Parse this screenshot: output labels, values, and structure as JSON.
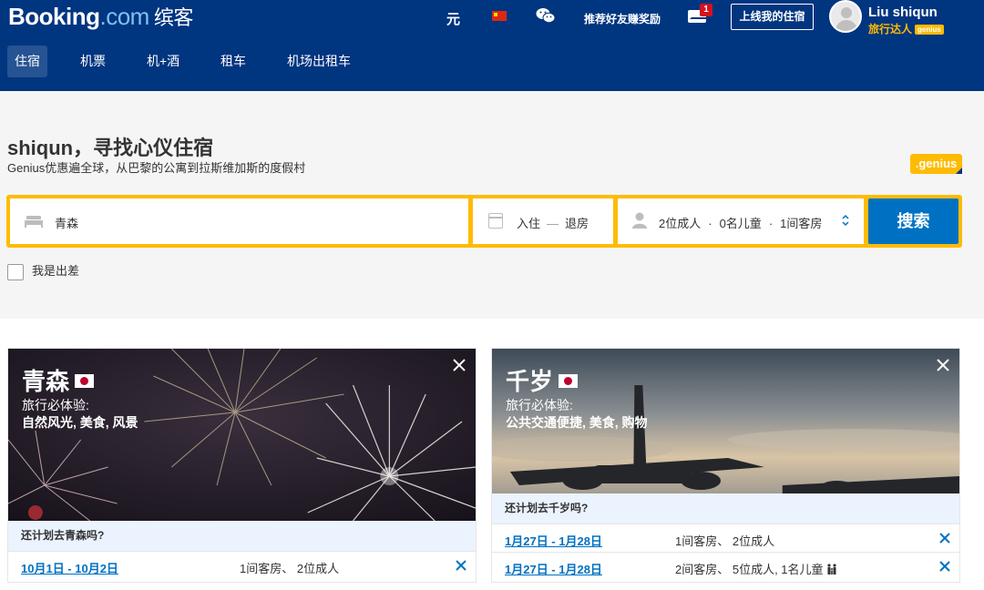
{
  "header": {
    "logo_main": "Booking",
    "logo_dotcom": ".com",
    "logo_cn": "缤客",
    "currency": "元",
    "language_icon": "china-flag-icon",
    "wechat_icon": "wechat-icon",
    "refer_label": "推荐好友赚奖励",
    "messages_icon": "mail-icon",
    "messages_count": "1",
    "list_property_label": "上线我的住宿",
    "user_name": "Liu shiqun",
    "user_level": "旅行达人",
    "user_badge": "genius"
  },
  "nav": {
    "tabs": [
      {
        "label": "住宿",
        "active": true
      },
      {
        "label": "机票",
        "active": false
      },
      {
        "label": "机+酒",
        "active": false
      },
      {
        "label": "租车",
        "active": false
      },
      {
        "label": "机场出租车",
        "active": false
      }
    ]
  },
  "hero": {
    "title": "shiqun，寻找心仪住宿",
    "subtitle": "Genius优惠遍全球，从巴黎的公寓到拉斯维加斯的度假村",
    "genius_badge": ".genius"
  },
  "search": {
    "destination": "青森",
    "checkin": "入住",
    "date_dash": "—",
    "checkout": "退房",
    "adults": "2位成人",
    "dot": "·",
    "children": "0名儿童",
    "rooms": "1间客房",
    "button": "搜索",
    "business_label": "我是出差"
  },
  "cards": [
    {
      "city": "青森",
      "exp_label": "旅行必体验:",
      "tags": "自然风光, 美食, 风景",
      "plan_label": "还计划去青森吗?",
      "trips": [
        {
          "dates": "10月1日 - 10月2日",
          "guests": "1间客房、 2位成人"
        }
      ]
    },
    {
      "city": "千岁",
      "exp_label": "旅行必体验:",
      "tags": "公共交通便捷, 美食, 购物",
      "plan_label": "还计划去千岁吗?",
      "trips": [
        {
          "dates": "1月27日 - 1月28日",
          "guests": "1间客房、 2位成人"
        },
        {
          "dates": "1月27日 - 1月28日",
          "guests": "2间客房、 5位成人, 1名儿童"
        }
      ]
    }
  ],
  "colors": {
    "brand_blue": "#003580",
    "accent_yellow": "#febb02",
    "action_blue": "#0071c2"
  }
}
